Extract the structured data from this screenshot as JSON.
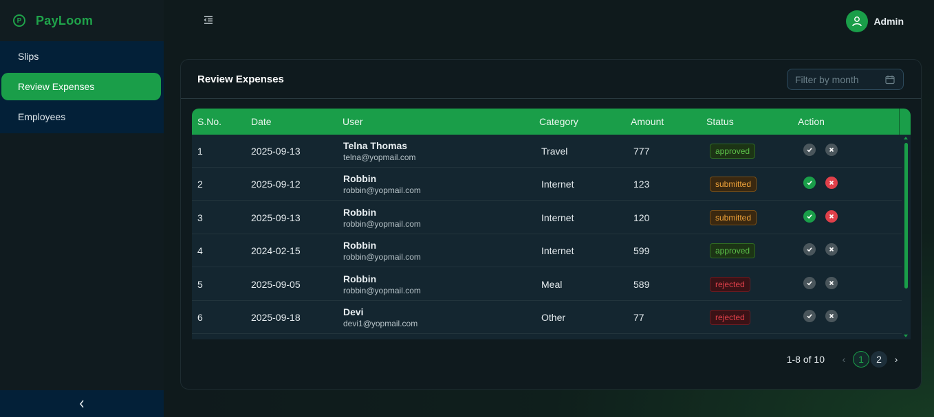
{
  "app": {
    "name": "PayLoom",
    "logo_glyph": "P"
  },
  "sidebar": {
    "items": [
      {
        "label": "Slips",
        "active": false
      },
      {
        "label": "Review Expenses",
        "active": true
      },
      {
        "label": "Employees",
        "active": false
      }
    ],
    "collapse_glyph": "‹"
  },
  "header": {
    "user_name": "Admin"
  },
  "card": {
    "title": "Review Expenses",
    "filter_placeholder": "Filter by month"
  },
  "table": {
    "columns": [
      "S.No.",
      "Date",
      "User",
      "Category",
      "Amount",
      "Status",
      "Action"
    ],
    "rows": [
      {
        "sno": "1",
        "date": "2025-09-13",
        "name": "Telna Thomas",
        "email": "telna@yopmail.com",
        "category": "Travel",
        "amount": "777",
        "status": "approved",
        "actions_enabled": false
      },
      {
        "sno": "2",
        "date": "2025-09-12",
        "name": "Robbin",
        "email": "robbin@yopmail.com",
        "category": "Internet",
        "amount": "123",
        "status": "submitted",
        "actions_enabled": true
      },
      {
        "sno": "3",
        "date": "2025-09-13",
        "name": "Robbin",
        "email": "robbin@yopmail.com",
        "category": "Internet",
        "amount": "120",
        "status": "submitted",
        "actions_enabled": true
      },
      {
        "sno": "4",
        "date": "2024-02-15",
        "name": "Robbin",
        "email": "robbin@yopmail.com",
        "category": "Internet",
        "amount": "599",
        "status": "approved",
        "actions_enabled": false
      },
      {
        "sno": "5",
        "date": "2025-09-05",
        "name": "Robbin",
        "email": "robbin@yopmail.com",
        "category": "Meal",
        "amount": "589",
        "status": "rejected",
        "actions_enabled": false
      },
      {
        "sno": "6",
        "date": "2025-09-18",
        "name": "Devi",
        "email": "devi1@yopmail.com",
        "category": "Other",
        "amount": "77",
        "status": "rejected",
        "actions_enabled": false
      }
    ]
  },
  "pagination": {
    "range": "1-8 of 10",
    "pages": [
      "1",
      "2"
    ],
    "current": "1"
  },
  "colors": {
    "accent": "#1a9e49",
    "sidebar_menu_bg": "#032038",
    "approved": "#5cc24a",
    "submitted": "#f0a33a",
    "rejected": "#e0404a"
  }
}
